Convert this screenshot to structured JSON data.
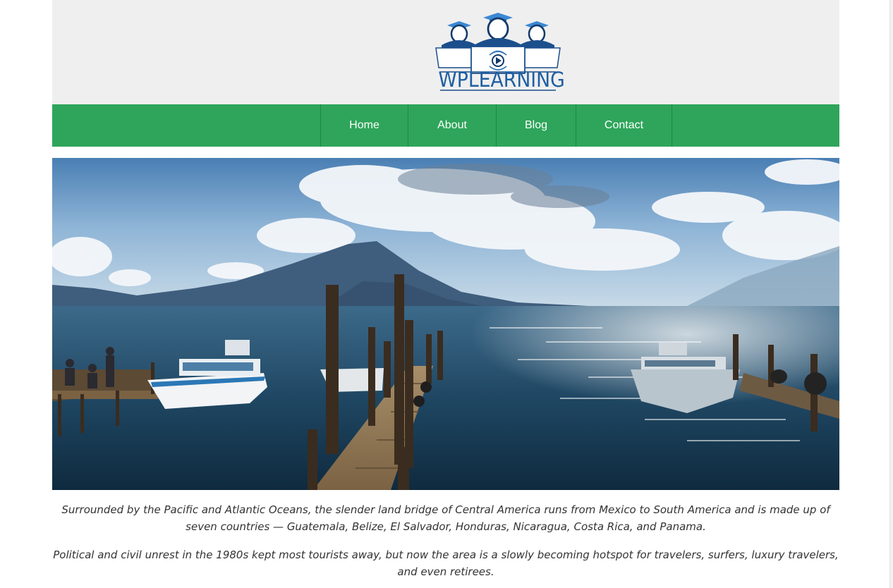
{
  "site": {
    "logo_text": "WPLEARNING",
    "logo_icon": "graduates-with-laptops-logo-icon"
  },
  "nav": {
    "items": [
      {
        "label": "Home"
      },
      {
        "label": "About"
      },
      {
        "label": "Blog"
      },
      {
        "label": "Contact"
      }
    ]
  },
  "hero": {
    "image": "lake-dock-boats-volcano-photo"
  },
  "content": {
    "paragraph1": "Surrounded by the Pacific and Atlantic Oceans, the slender land bridge of Central America runs from Mexico to South America and is made up of seven countries — Guatemala, Belize, El Salvador, Honduras, Nicaragua, Costa Rica, and Panama.",
    "paragraph2": "Political and civil unrest in the 1980s kept most tourists away, but now the area is a slowly becoming hotspot for travelers, surfers, luxury travelers, and even retirees."
  },
  "colors": {
    "nav_green": "#2ea55a",
    "header_gray": "#efefef",
    "logo_blue": "#1f5fa3"
  }
}
